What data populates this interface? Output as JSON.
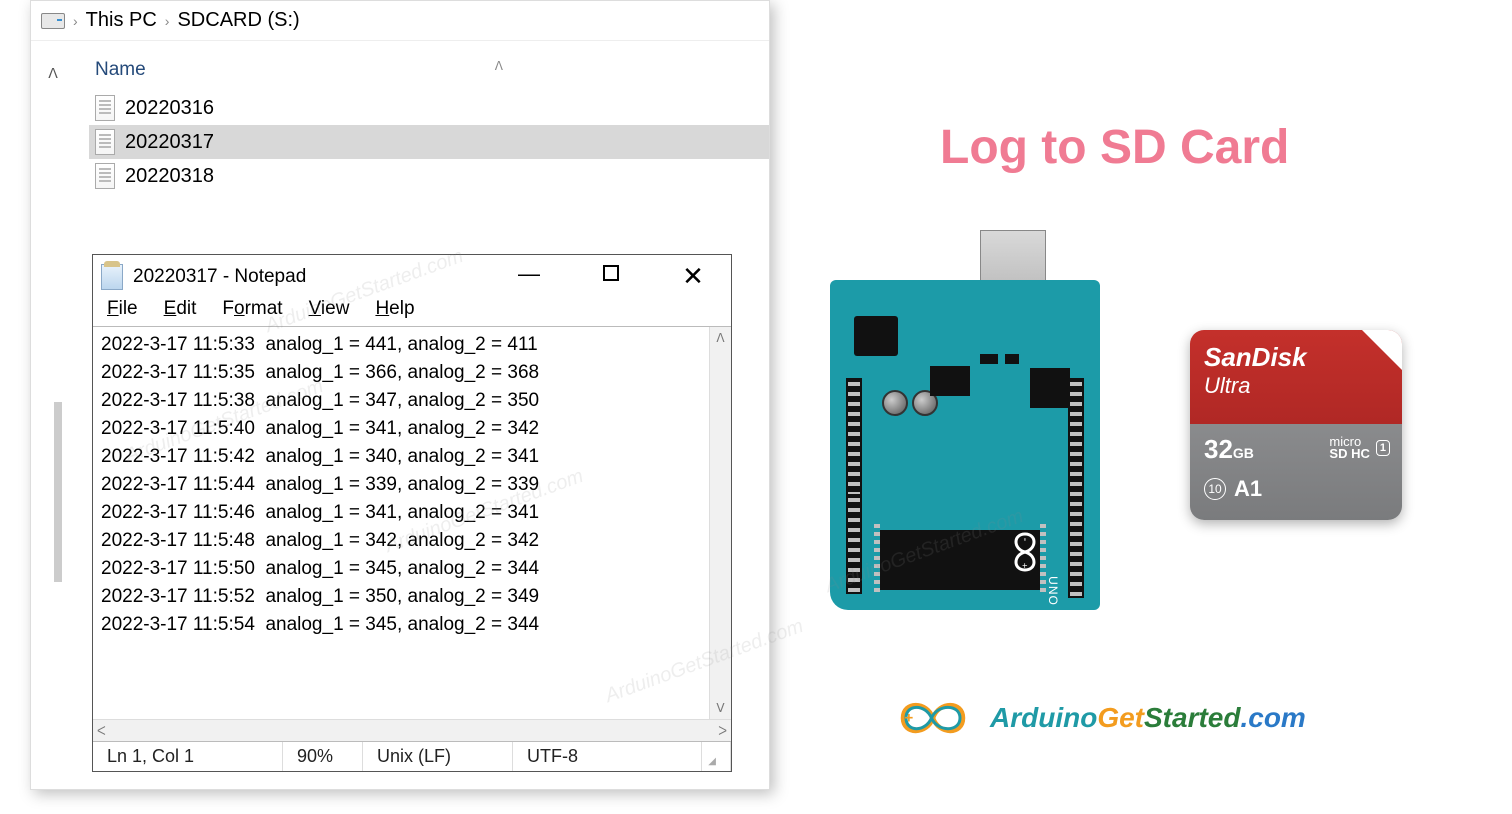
{
  "breadcrumb": {
    "items": [
      "This PC",
      "SDCARD (S:)"
    ]
  },
  "columns": {
    "name": "Name"
  },
  "files": [
    {
      "name": "20220316",
      "selected": false
    },
    {
      "name": "20220317",
      "selected": true
    },
    {
      "name": "20220318",
      "selected": false
    }
  ],
  "notepad": {
    "title": "20220317 - Notepad",
    "menu": [
      "File",
      "Edit",
      "Format",
      "View",
      "Help"
    ],
    "lines": [
      "2022-3-17 11:5:33  analog_1 = 441, analog_2 = 411",
      "2022-3-17 11:5:35  analog_1 = 366, analog_2 = 368",
      "2022-3-17 11:5:38  analog_1 = 347, analog_2 = 350",
      "2022-3-17 11:5:40  analog_1 = 341, analog_2 = 342",
      "2022-3-17 11:5:42  analog_1 = 340, analog_2 = 341",
      "2022-3-17 11:5:44  analog_1 = 339, analog_2 = 339",
      "2022-3-17 11:5:46  analog_1 = 341, analog_2 = 341",
      "2022-3-17 11:5:48  analog_1 = 342, analog_2 = 342",
      "2022-3-17 11:5:50  analog_1 = 345, analog_2 = 344",
      "2022-3-17 11:5:52  analog_1 = 350, analog_2 = 349",
      "2022-3-17 11:5:54  analog_1 = 345, analog_2 = 344"
    ],
    "status": {
      "pos": "Ln 1, Col 1",
      "zoom": "90%",
      "eol": "Unix (LF)",
      "enc": "UTF-8"
    }
  },
  "heading": "Log to SD Card",
  "arduino": {
    "uno_label": "UNO",
    "brand": "ARDUINO"
  },
  "sdcard": {
    "brand": "SanDisk",
    "line": "Ultra",
    "capacity": "32",
    "cap_unit": "GB",
    "micro": "micro",
    "sdhc": "SD HC",
    "u1": "1",
    "c10": "10",
    "a1": "A1"
  },
  "logo": {
    "arduino": "Arduino",
    "get": "Get",
    "started": "Started",
    "dotcom": ".com"
  },
  "watermark": "ArduinoGetStarted.com"
}
